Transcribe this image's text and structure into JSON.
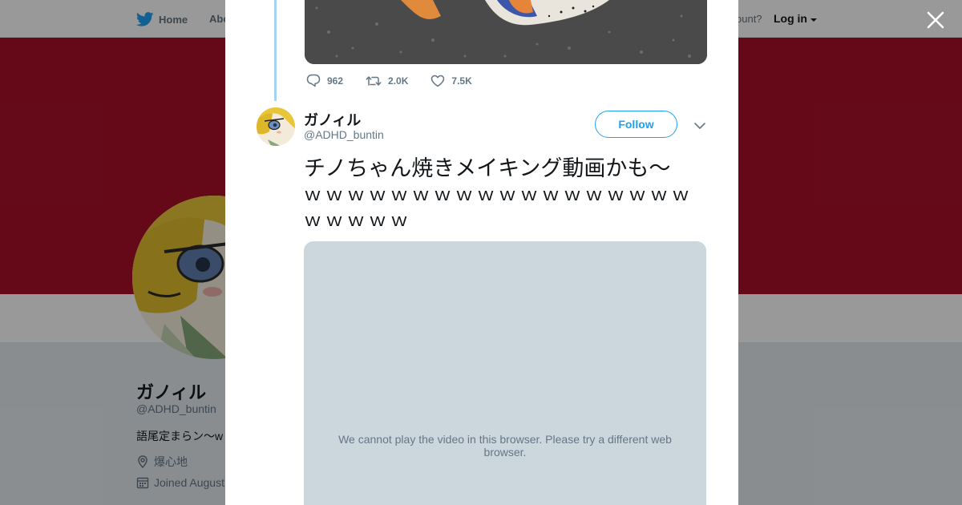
{
  "nav": {
    "home_label": "Home",
    "about_label": "Abo",
    "account_prompt": "ccount?",
    "login_label": "Log in"
  },
  "colors": {
    "banner": "#a8102a",
    "twitter_blue": "#1da1f2",
    "thread_line": "#a3d4f5",
    "video_placeholder": "#ccd6dd"
  },
  "profile": {
    "name": "ガノィル",
    "handle": "@ADHD_buntin",
    "bio": "語尾定まらン〜w",
    "location": "爆心地",
    "joined": "Joined August"
  },
  "previous_tweet": {
    "replies": "962",
    "retweets": "2.0K",
    "likes": "7.5K"
  },
  "tweet": {
    "author_name": "ガノィル",
    "author_handle": "@ADHD_buntin",
    "follow_label": "Follow",
    "text_line1": "チノちゃん焼きメイキング動画かも〜",
    "text_line2": "ｗｗｗｗｗｗｗｗｗｗｗｗｗｗｗｗｗｗｗｗｗｗｗ",
    "video_message": "We cannot play the video in this browser. Please try a different web browser."
  },
  "icons": [
    "twitter-bird-icon",
    "caret-down-icon",
    "close-icon",
    "reply-icon",
    "retweet-icon",
    "heart-icon",
    "location-pin-icon",
    "calendar-icon",
    "chevron-down-icon"
  ]
}
